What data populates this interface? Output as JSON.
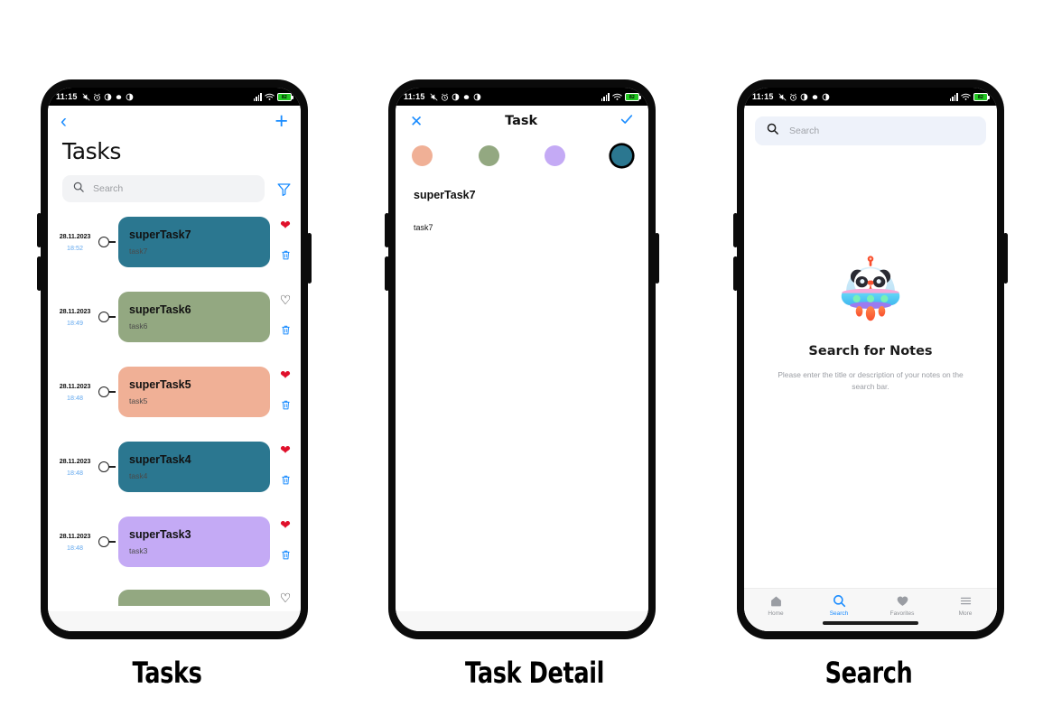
{
  "statusbar": {
    "time": "11:15",
    "battery_text": "82",
    "icons": [
      "mute-icon",
      "alarm-icon",
      "contrast-icon",
      "apple-icon",
      "contrast-icon-2"
    ],
    "right_icons": [
      "signal-icon",
      "wifi-icon",
      "battery-icon"
    ]
  },
  "screens": [
    {
      "caption": "Tasks",
      "nav": {
        "back": "‹",
        "add": "+"
      },
      "title": "Tasks",
      "search": {
        "placeholder": "Search",
        "icon": "search-icon",
        "filter_icon": "filter-icon"
      },
      "tasks": [
        {
          "date": "28.11.2023",
          "time": "18:52",
          "title": "superTask7",
          "subtitle": "task7",
          "color": "#2b7790",
          "favorite": true
        },
        {
          "date": "28.11.2023",
          "time": "18:49",
          "title": "superTask6",
          "subtitle": "task6",
          "color": "#93a881",
          "favorite": false
        },
        {
          "date": "28.11.2023",
          "time": "18:48",
          "title": "superTask5",
          "subtitle": "task5",
          "color": "#f0b096",
          "favorite": true
        },
        {
          "date": "28.11.2023",
          "time": "18:48",
          "title": "superTask4",
          "subtitle": "task4",
          "color": "#2b7790",
          "favorite": true
        },
        {
          "date": "28.11.2023",
          "time": "18:48",
          "title": "superTask3",
          "subtitle": "task3",
          "color": "#c4aaf5",
          "favorite": true
        },
        {
          "date": "",
          "time": "",
          "title": "",
          "subtitle": "",
          "color": "#93a881",
          "favorite": false
        }
      ]
    },
    {
      "caption": "Task Detail",
      "nav": {
        "close": "✕",
        "title": "Task",
        "confirm": "check-icon"
      },
      "swatches": [
        {
          "color": "#f0b096",
          "selected": false
        },
        {
          "color": "#93a881",
          "selected": false
        },
        {
          "color": "#c4aaf5",
          "selected": false
        },
        {
          "color": "#2b7790",
          "selected": true
        }
      ],
      "detail": {
        "title": "superTask7",
        "body": "task7"
      }
    },
    {
      "caption": "Search",
      "search": {
        "placeholder": "Search",
        "icon": "search-icon"
      },
      "empty": {
        "illustration": "panda-ufo-illustration",
        "title": "Search for Notes",
        "subtitle": "Please enter the title or description of your notes on the search bar."
      },
      "tabs": [
        {
          "label": "Home",
          "icon": "home-icon",
          "active": false
        },
        {
          "label": "Search",
          "icon": "search-icon",
          "active": true
        },
        {
          "label": "Favorites",
          "icon": "heart-icon",
          "active": false
        },
        {
          "label": "More",
          "icon": "menu-icon",
          "active": false
        }
      ]
    }
  ],
  "colors": {
    "accent_blue": "#1a8cff",
    "favorite_red": "#e0102b",
    "teal": "#2b7790",
    "sage": "#93a881",
    "peach": "#f0b096",
    "lavender": "#c4aaf5"
  }
}
